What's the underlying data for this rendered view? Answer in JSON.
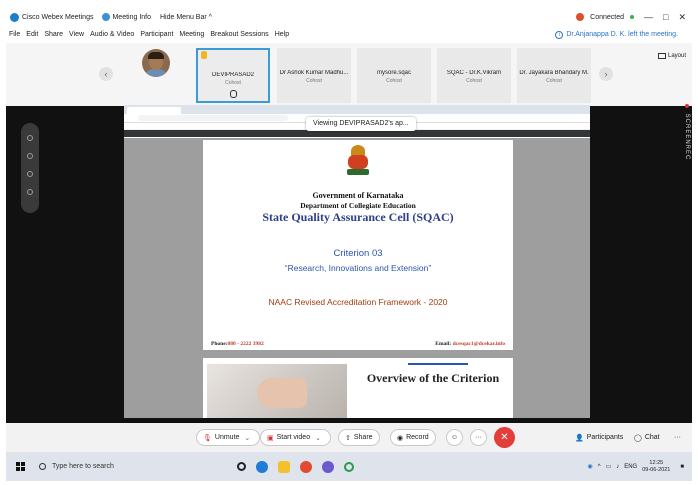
{
  "titlebar": {
    "app_title": "Cisco Webex Meetings",
    "meeting_info": "Meeting Info",
    "hide_menu": "Hide Menu Bar ^",
    "status": "Connected",
    "win_min": "—",
    "win_max": "□",
    "win_close": "✕"
  },
  "menu": {
    "items": [
      "File",
      "Edit",
      "Share",
      "View",
      "Audio & Video",
      "Participant",
      "Meeting",
      "Breakout Sessions",
      "Help"
    ],
    "notification": "Dr.Anjanappa D. K. left the meeting."
  },
  "participants": {
    "prev_arrow": "‹",
    "next_arrow": "›",
    "layout_label": "Layout",
    "tiles": [
      {
        "name": "DEVIPRASAD2",
        "role": "Cohost"
      },
      {
        "name": "Dr Ashok Kumar Madhu...",
        "role": "Cohost"
      },
      {
        "name": "mysore.sqac",
        "role": "Cohost"
      },
      {
        "name": "SQAC - Dr.K.Vikram",
        "role": "Cohost"
      },
      {
        "name": "Dr. Jayakara Bhandary M.",
        "role": "Cohost"
      }
    ]
  },
  "share": {
    "viewing_label": "Viewing DEVIPRASAD2's ap...",
    "recording_label": "SCREENREC"
  },
  "slide": {
    "government": "Government of Karnataka",
    "department": "Department of Collegiate Education",
    "cell": "State Quality Assurance Cell (SQAC)",
    "criterion": "Criterion 03",
    "criterion_title": "“Research, Innovations and Extension”",
    "framework": "NAAC Revised Accreditation Framework - 2020",
    "phone_label": "Phone:",
    "phone_value": "080 - 2222 3982",
    "email_label": "Email: ",
    "email_value": "dcesqac1@dcekar.info",
    "overview": "Overview of the Criterion"
  },
  "controls": {
    "unmute": "Unmute",
    "start_video": "Start video",
    "share": "Share",
    "record": "Record",
    "end_symbol": "✕",
    "participants": "Participants",
    "chat": "Chat",
    "more": "···"
  },
  "taskbar": {
    "search_placeholder": "Type here to search",
    "lang": "ENG",
    "time": "12:25",
    "date": "09-06-2021"
  },
  "colors": {
    "accent": "#3b9ad8",
    "end_call": "#e23e3a",
    "sqac_blue": "#2d3f8c"
  }
}
